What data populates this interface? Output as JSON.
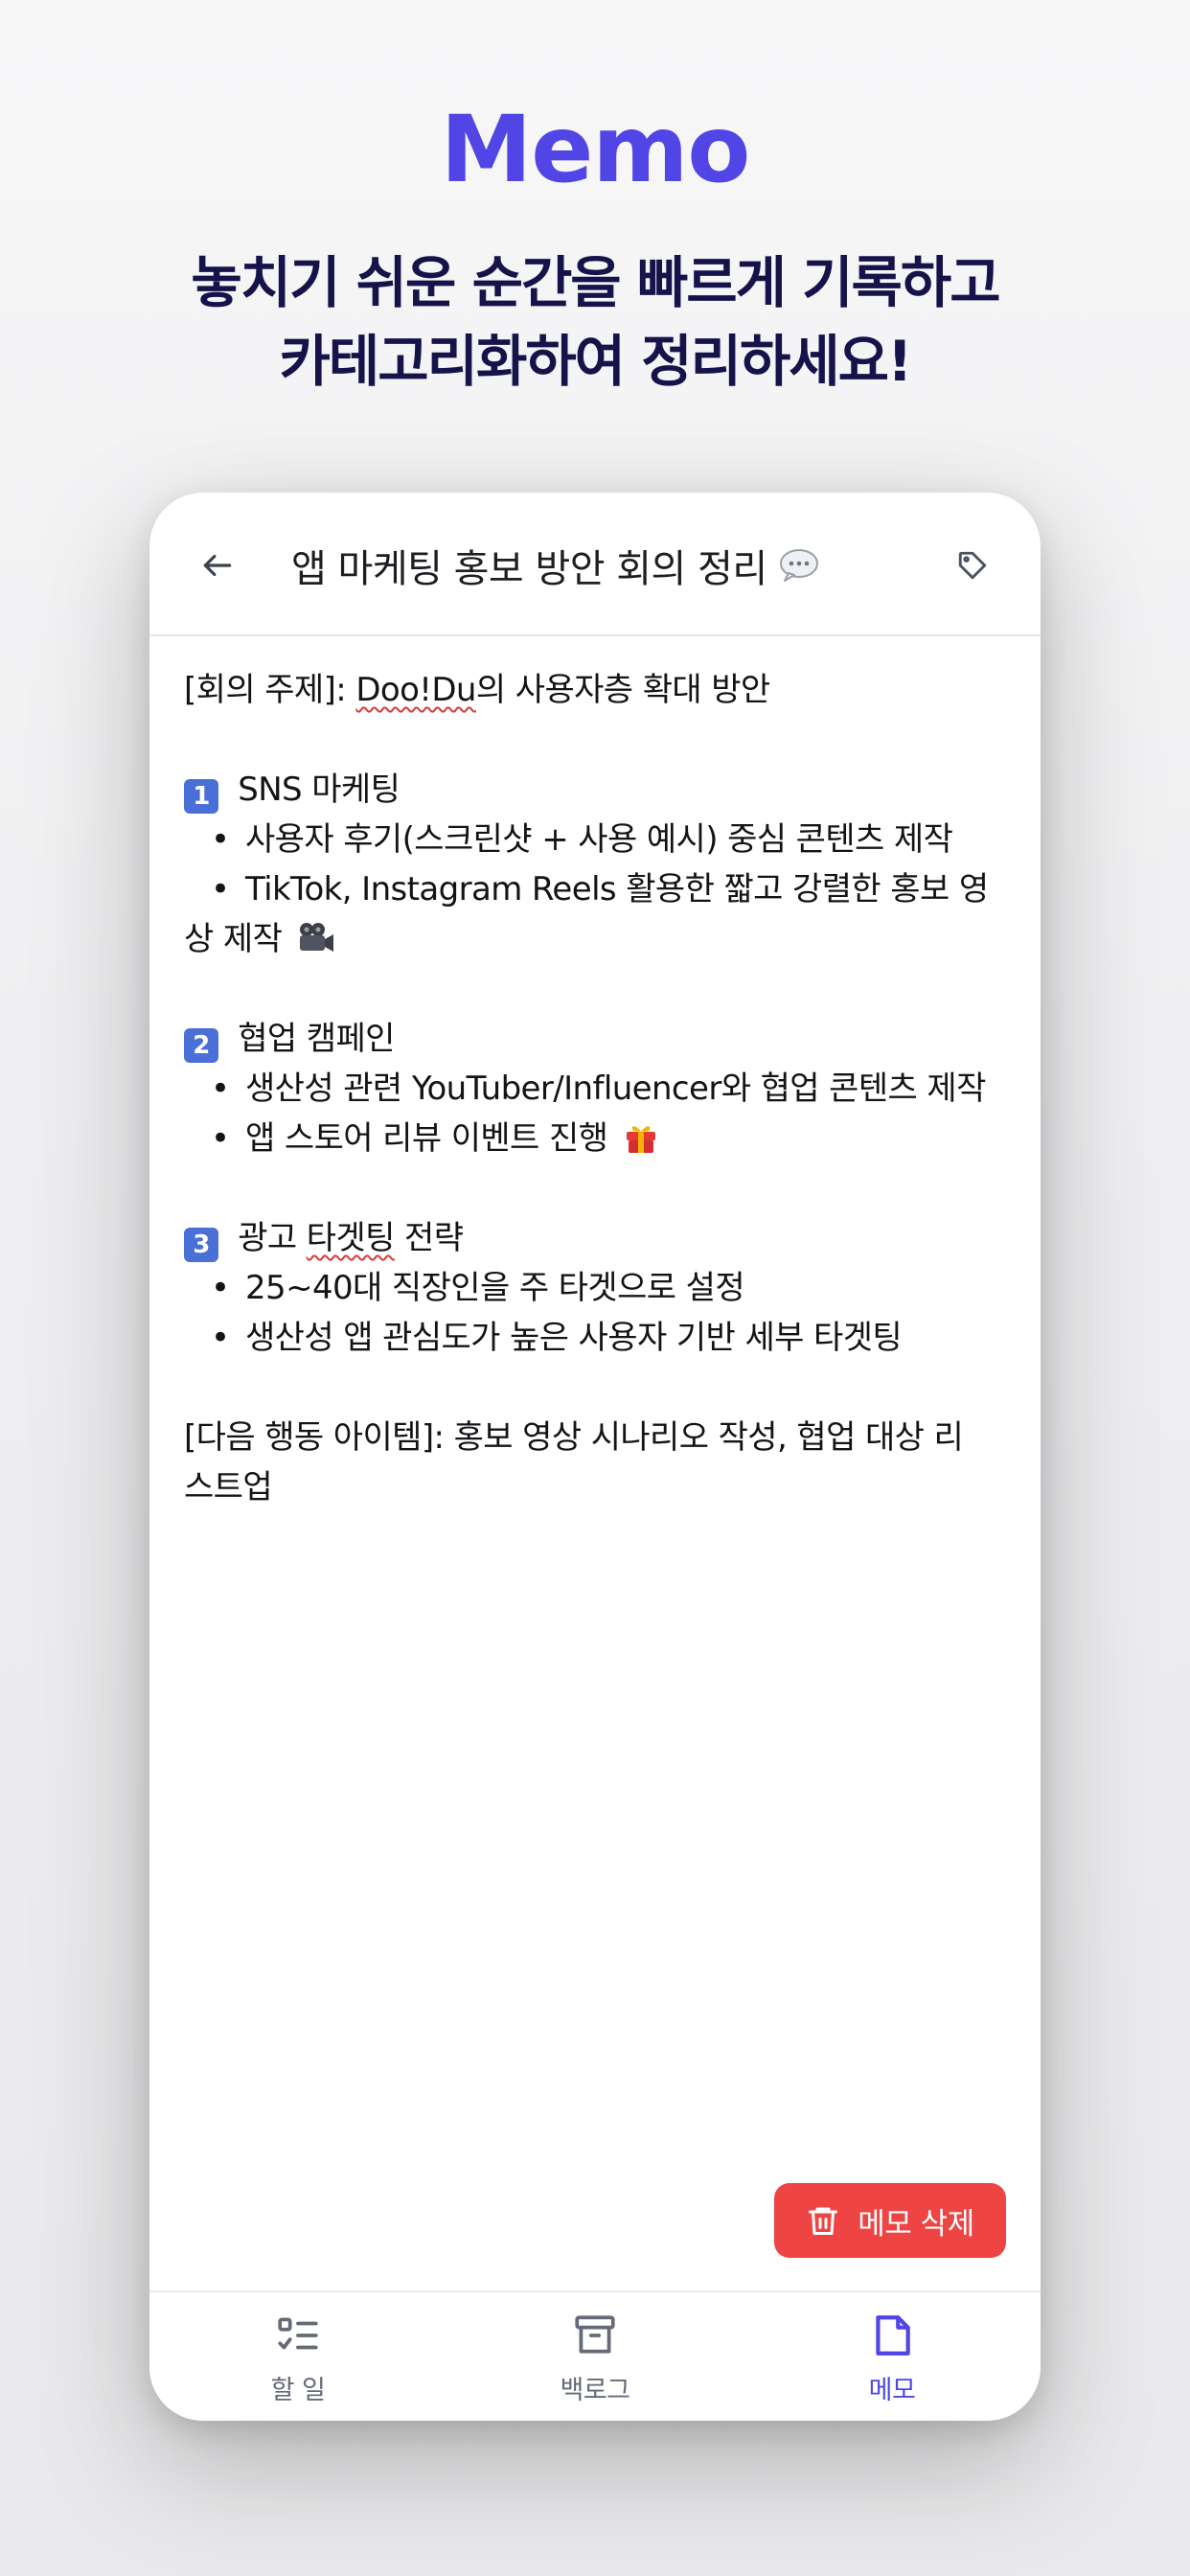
{
  "promo": {
    "title": "Memo",
    "subtitle_line1": "놓치기 쉬운 순간을 빠르게 기록하고",
    "subtitle_line2": "카테고리화하여 정리하세요!"
  },
  "header": {
    "title": "앱 마케팅 홍보 방안 회의 정리"
  },
  "memo": {
    "topic_prefix": "[회의 주제]: ",
    "topic_brand": "Doo!Du",
    "topic_suffix": "의 사용자층 확대 방안",
    "s1_num": "1",
    "s1_title": " SNS 마케팅",
    "s1_b1": "사용자 후기(스크린샷 + 사용 예시) 중심 콘텐츠 제작",
    "s1_b2a": "TikTok, Instagram Reels 활용한 짧고 강렬한 홍보 영",
    "s1_b2b": "상 제작",
    "s2_num": "2",
    "s2_title": " 협업 캠페인",
    "s2_b1": "생산성 관련 YouTuber/Influencer와 협업 콘텐츠 제작",
    "s2_b2": "앱 스토어 리뷰 이벤트 진행",
    "s3_num": "3",
    "s3_title_a": " 광고 ",
    "s3_title_b": "타겟팅",
    "s3_title_c": " 전략",
    "s3_b1": "25~40대 직장인을 주 타겟으로 설정",
    "s3_b2": "생산성 앱 관심도가 높은 사용자 기반 세부 타겟팅",
    "next_a": "[다음 행동 아이템]: 홍보 영상 시나리오 작성, 협업 대상 리",
    "next_b": "스트업",
    "bullet": "•"
  },
  "actions": {
    "delete_label": "메모 삭제"
  },
  "tabs": [
    {
      "label": "할 일",
      "icon": "checklist-icon"
    },
    {
      "label": "백로그",
      "icon": "archive-box-icon"
    },
    {
      "label": "메모",
      "icon": "note-icon"
    }
  ],
  "colors": {
    "brand": "#5146e5",
    "headline": "#16124a",
    "delete": "#ef4444",
    "tab_active": "#4f46e5",
    "tab_inactive": "#666a78"
  }
}
